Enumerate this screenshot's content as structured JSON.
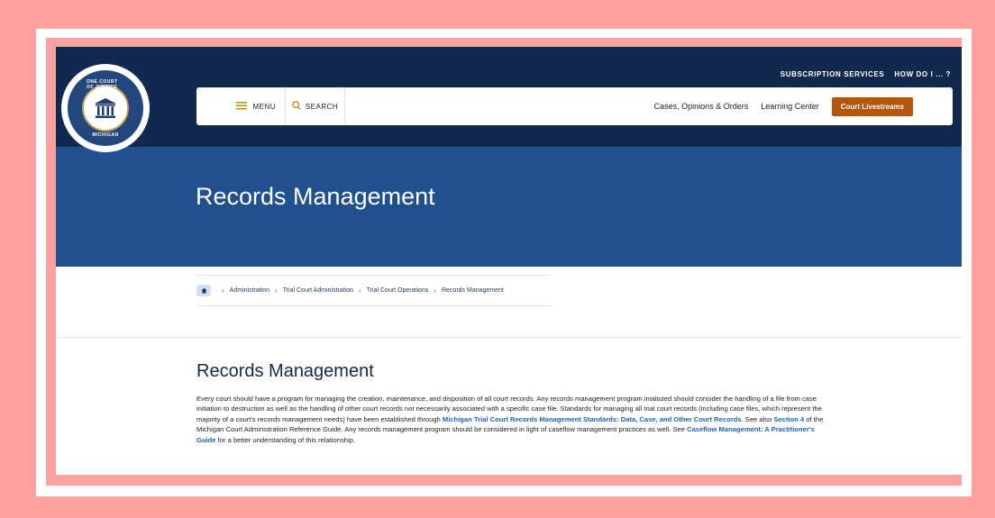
{
  "seal": {
    "top_text": "ONE COURT OF JUSTICE",
    "bottom_text": "MICHIGAN",
    "colors": {
      "ring": "#22467e",
      "gold": "#c5a15a"
    }
  },
  "utility_nav": {
    "subscription": "SUBSCRIPTION SERVICES",
    "how_do_i": "HOW DO I ... ?"
  },
  "navbar": {
    "menu_label": "MENU",
    "search_label": "SEARCH",
    "links": [
      "Cases, Opinions & Orders",
      "Learning Center"
    ],
    "livestream_label": "Court Livestreams"
  },
  "hero": {
    "title": "Records Management"
  },
  "breadcrumb": {
    "items": [
      "Administration",
      "Trial Court Administration",
      "Trial Court Operations",
      "Records Management"
    ]
  },
  "content": {
    "title": "Records Management",
    "p1": "Every court should have a program for managing the creation, maintenance, and disposition of all court records. Any records management program instituted should consider the handling of a file from case initiation to destruction as well as the handling of other court records not necessarily associated with a specific case file. Standards for managing all trial court records (including case files, which represent the majority of a court's records management needs) have been established through ",
    "link1": "Michigan Trial Court Records Management Standards: Data, Case, and Other Court Records",
    "p2": ". See also ",
    "link2": "Section 4",
    "p3": " of the Michigan Court Administration Reference Guide. Any records management program should be considered in light of caseflow management practices as well. See ",
    "link3": "Caseflow Management: A Practitioner's Guide",
    "p4": " for a better understanding of this relationship."
  },
  "colors": {
    "header_bg": "#12294f",
    "hero_bg": "#20508f",
    "accent_button": "#b3560e",
    "link": "#1f63b4",
    "frame": "#ffa1a1"
  }
}
